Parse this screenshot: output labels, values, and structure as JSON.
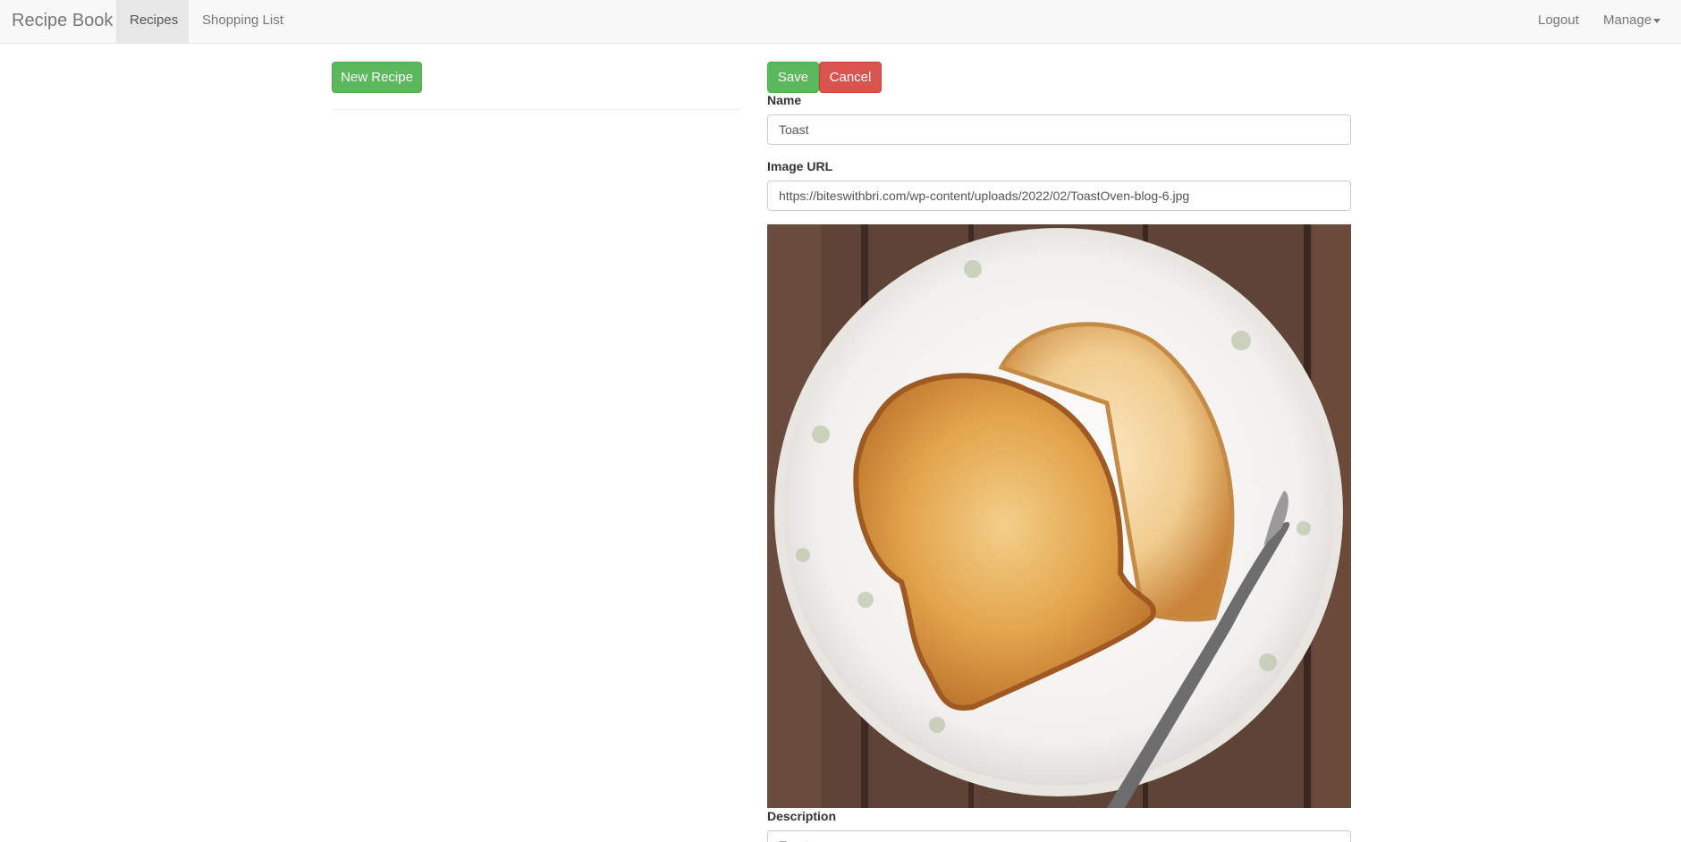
{
  "navbar": {
    "brand": "Recipe Book",
    "links": [
      {
        "label": "Recipes",
        "active": true
      },
      {
        "label": "Shopping List",
        "active": false
      }
    ],
    "right_links": [
      {
        "label": "Logout"
      },
      {
        "label": "Manage"
      }
    ]
  },
  "recipe_list": {
    "new_button": "New Recipe"
  },
  "editor": {
    "save_label": "Save",
    "cancel_label": "Cancel",
    "name_label": "Name",
    "name_value": "Toast",
    "image_url_label": "Image URL",
    "image_url_value": "https://biteswithbri.com/wp-content/uploads/2022/02/ToastOven-blog-6.jpg",
    "description_label": "Description",
    "description_value": "Toast"
  },
  "colors": {
    "success": "#5cb85c",
    "danger": "#d9534f",
    "navbar_bg": "#f8f8f8"
  }
}
